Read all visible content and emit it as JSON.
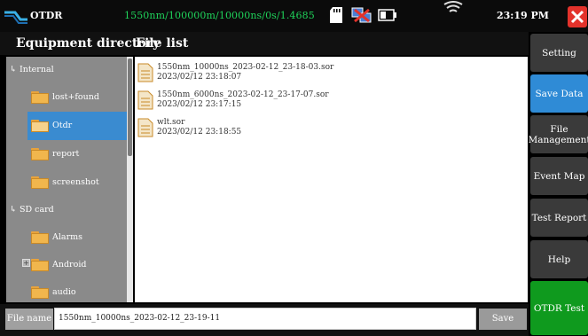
{
  "topbar": {
    "app_title": "OTDR",
    "params": "1550nm/100000m/10000ns/0s/1.4685",
    "clock": "23:19 PM"
  },
  "header": {
    "dir_title": "Equipment directory",
    "files_title": "File list"
  },
  "tree": {
    "internal_label": "Internal",
    "internal_folders": [
      "lost+found",
      "Otdr",
      "report",
      "screenshot"
    ],
    "selected_folder": "Otdr",
    "sd_label": "SD card",
    "sd_folders": [
      "Alarms",
      "Android",
      "audio"
    ],
    "expander_symbol": "+"
  },
  "files": [
    {
      "name": "1550nm_10000ns_2023-02-12_23-18-03.sor",
      "date": "2023/02/12  23:18:07"
    },
    {
      "name": "1550nm_6000ns_2023-02-12_23-17-07.sor",
      "date": "2023/02/12  23:17:15"
    },
    {
      "name": "wlt.sor",
      "date": "2023/02/12  23:18:55"
    }
  ],
  "bottom": {
    "file_name_label": "File name",
    "file_name_value": "1550nm_10000ns_2023-02-12_23-19-11",
    "save_label": "Save"
  },
  "menu": {
    "setting": "Setting",
    "save_data": "Save Data",
    "file_management": "File Management",
    "event_map": "Event Map",
    "test_report": "Test Report",
    "help": "Help",
    "otdr_test": "OTDR Test"
  },
  "colors": {
    "accent_blue": "#2f8bd6",
    "green_button": "#0f9a1e",
    "params_green": "#1fd25a",
    "close_red": "#e3322b"
  },
  "icons": [
    "otdr-logo-icon",
    "sd-card-icon",
    "network-icon",
    "battery-icon",
    "wifi-icon",
    "close-icon",
    "folder-icon",
    "file-icon"
  ]
}
